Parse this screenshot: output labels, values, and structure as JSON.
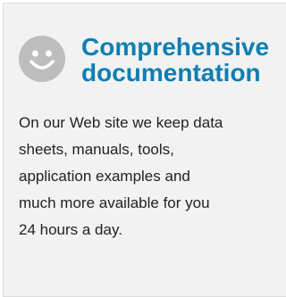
{
  "feature": {
    "icon": "smiley-face-icon",
    "title_line1": "Comprehensive",
    "title_line2": "documentation",
    "body_lines": [
      "On our Web site we keep data",
      "sheets, manuals, tools,",
      "application examples and",
      "much more available for you",
      "24 hours a day."
    ]
  },
  "colors": {
    "title": "#0e7fb0",
    "card_background": "#f2f2f2",
    "icon_fill": "#bdbdbd",
    "text": "#222222"
  }
}
